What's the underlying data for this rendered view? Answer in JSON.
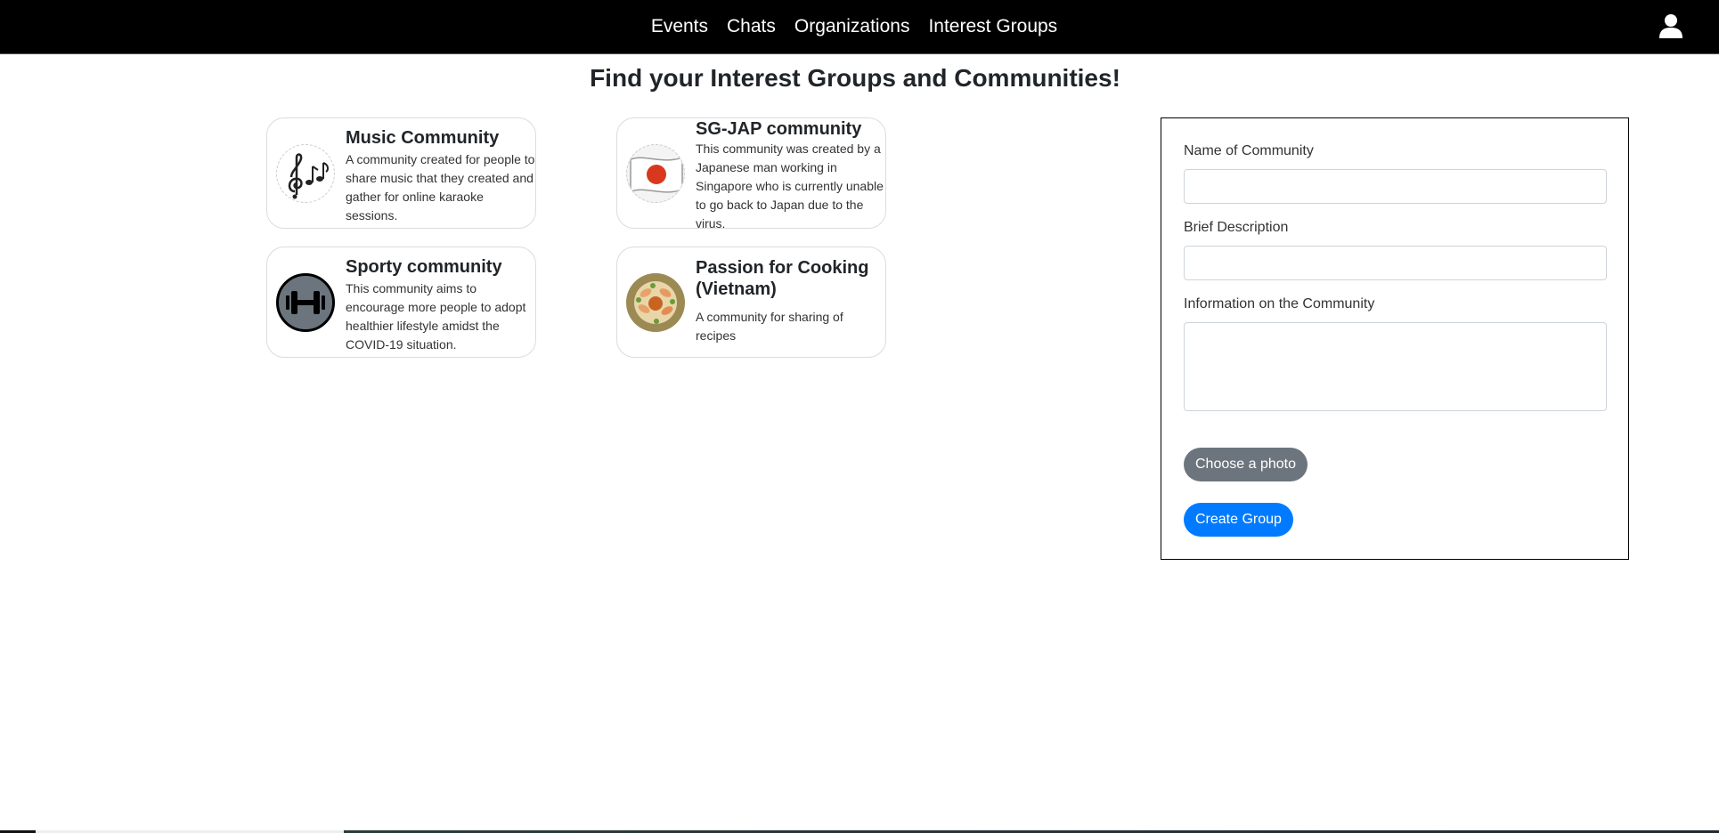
{
  "nav": {
    "links": [
      "Events",
      "Chats",
      "Organizations",
      "Interest Groups"
    ]
  },
  "page": {
    "title": "Find your Interest Groups and Communities!"
  },
  "communities": [
    {
      "name": "Music Community",
      "description": "A community created for people to share music that they created and gather for online karaoke sessions.",
      "icon": "music-notes-icon"
    },
    {
      "name": "SG-JAP community",
      "description": "This community was created by a Japanese man working in Singapore who is currently unable to go back to Japan due to the virus.",
      "icon": "japan-flag-icon"
    },
    {
      "name": "Sporty community",
      "description": "This community aims to encourage more people to adopt healthier lifestyle amidst the COVID-19 situation.",
      "icon": "dumbbell-icon"
    },
    {
      "name": "Passion for Cooking (Vietnam)",
      "description": "A community for sharing of recipes",
      "icon": "food-plate-icon"
    }
  ],
  "form": {
    "name_label": "Name of Community",
    "name_value": "",
    "description_label": "Brief Description",
    "description_value": "",
    "info_label": "Information on the Community",
    "info_value": "",
    "photo_button": "Choose a photo",
    "create_button": "Create Group"
  },
  "colors": {
    "navbar": "#000000",
    "primary": "#007bff",
    "secondary": "#6c757d"
  }
}
